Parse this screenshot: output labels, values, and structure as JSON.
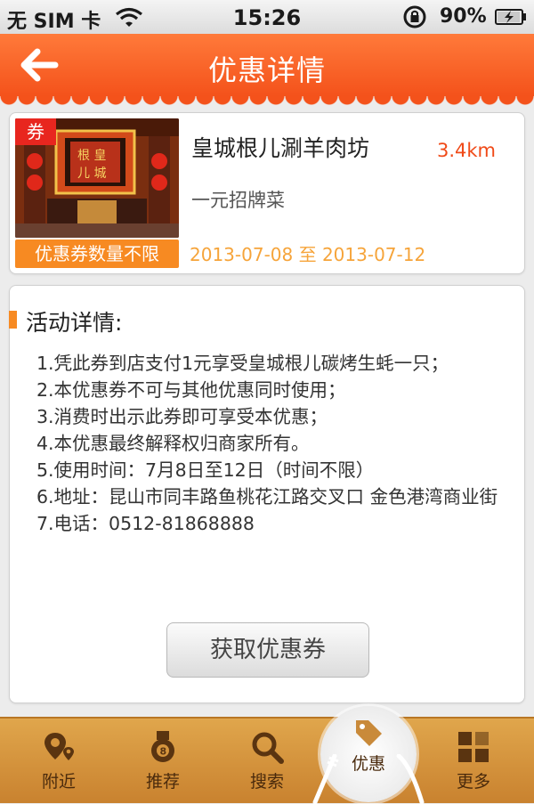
{
  "status_bar": {
    "carrier": "无 SIM 卡",
    "time": "15:26",
    "battery_percent": "90%"
  },
  "header": {
    "title": "优惠详情",
    "back_icon": "back-arrow-icon"
  },
  "store": {
    "coupon_tag": "券",
    "name": "皇城根儿涮羊肉坊",
    "distance": "3.4km",
    "deal": "一元招牌菜",
    "quantity_badge": "优惠券数量不限",
    "date_start": "2013-07-08",
    "date_sep": "至",
    "date_end": "2013-07-12"
  },
  "details": {
    "heading": "活动详情:",
    "lines": [
      "1.凭此券到店支付1元享受皇城根儿碳烤生蚝一只；",
      "2.本优惠券不可与其他优惠同时使用；",
      "3.消费时出示此券即可享受本优惠；",
      "4.本优惠最终解释权归商家所有。",
      "5.使用时间：7月8日至12日（时间不限）",
      "6.地址：昆山市同丰路鱼桃花江路交叉口 金色港湾商业街",
      "7.电话：0512-81868888"
    ],
    "get_button": "获取优惠券"
  },
  "tabbar": {
    "items": [
      {
        "label": "附近",
        "icon": "location-pin-icon"
      },
      {
        "label": "推荐",
        "icon": "medal-icon"
      },
      {
        "label": "搜索",
        "icon": "search-icon"
      },
      {
        "label": "优惠",
        "icon": "tag-icon",
        "active": true
      },
      {
        "label": "更多",
        "icon": "grid-icon"
      }
    ]
  },
  "colors": {
    "accent_orange": "#f4521b",
    "badge_orange": "#f78a22",
    "tag_red": "#e8261f",
    "date_text": "#f6a43a",
    "tabbar_wood": "#d6953d"
  }
}
